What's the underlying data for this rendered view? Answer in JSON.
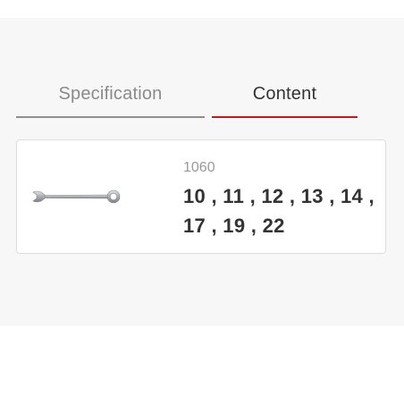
{
  "tabs": [
    {
      "label": "Specification"
    },
    {
      "label": "Content"
    }
  ],
  "product": {
    "code": "1060",
    "sizes": "10 , 11 , 12 , 13 , 14 , 17 , 19 , 22",
    "image_icon": "combination-wrench-icon"
  },
  "colors": {
    "active_tab_underline": "#c2191f",
    "inactive_tab_underline": "#8f8f8f",
    "panel_background": "#f7f7f7"
  }
}
